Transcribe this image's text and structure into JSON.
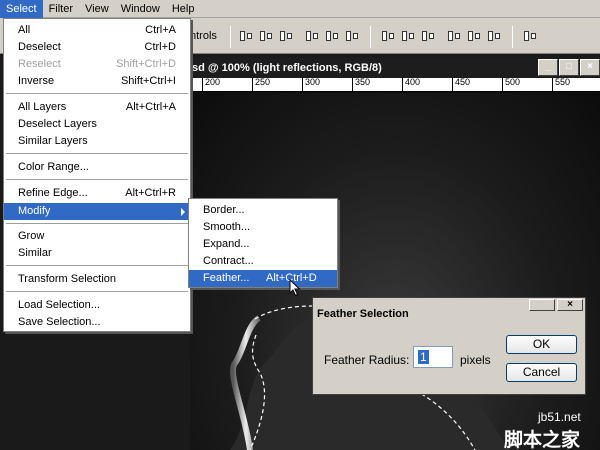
{
  "menubar": {
    "items": [
      {
        "label": "Select",
        "active": true
      },
      {
        "label": "Filter"
      },
      {
        "label": "View"
      },
      {
        "label": "Window"
      },
      {
        "label": "Help"
      }
    ]
  },
  "options_bar": {
    "controls_label": "ntrols"
  },
  "document": {
    "title": "sd @ 100% (light reflections, RGB/8)",
    "ruler_ticks": [
      "200",
      "250",
      "300",
      "350",
      "400",
      "450",
      "500",
      "550"
    ],
    "window_buttons": [
      "_",
      "□",
      "×"
    ]
  },
  "select_menu": {
    "items": [
      {
        "label": "All",
        "shortcut": "Ctrl+A"
      },
      {
        "label": "Deselect",
        "shortcut": "Ctrl+D"
      },
      {
        "label": "Reselect",
        "shortcut": "Shift+Ctrl+D",
        "disabled": true
      },
      {
        "label": "Inverse",
        "shortcut": "Shift+Ctrl+I"
      },
      {
        "label": "All Layers",
        "shortcut": "Alt+Ctrl+A"
      },
      {
        "label": "Deselect Layers",
        "shortcut": ""
      },
      {
        "label": "Similar Layers",
        "shortcut": ""
      },
      {
        "label": "Color Range...",
        "shortcut": ""
      },
      {
        "label": "Refine Edge...",
        "shortcut": "Alt+Ctrl+R"
      },
      {
        "label": "Modify",
        "shortcut": "",
        "active": true
      },
      {
        "label": "Grow",
        "shortcut": ""
      },
      {
        "label": "Similar",
        "shortcut": ""
      },
      {
        "label": "Transform Selection",
        "shortcut": ""
      },
      {
        "label": "Load Selection...",
        "shortcut": ""
      },
      {
        "label": "Save Selection...",
        "shortcut": ""
      }
    ]
  },
  "modify_submenu": {
    "items": [
      {
        "label": "Border..."
      },
      {
        "label": "Smooth..."
      },
      {
        "label": "Expand..."
      },
      {
        "label": "Contract..."
      },
      {
        "label": "Feather...",
        "shortcut": "Alt+Ctrl+D",
        "active": true
      }
    ]
  },
  "feather_dialog": {
    "title": "Feather Selection",
    "radius_label": "Feather Radius:",
    "radius_value": "1",
    "unit": "pixels",
    "ok_label": "OK",
    "cancel_label": "Cancel",
    "close_glyph": "×"
  },
  "watermark": {
    "line1": "jb51.net",
    "line2": "脚本之家"
  },
  "colors": {
    "highlight": "#316ac5",
    "chrome": "#d4d0c8"
  }
}
